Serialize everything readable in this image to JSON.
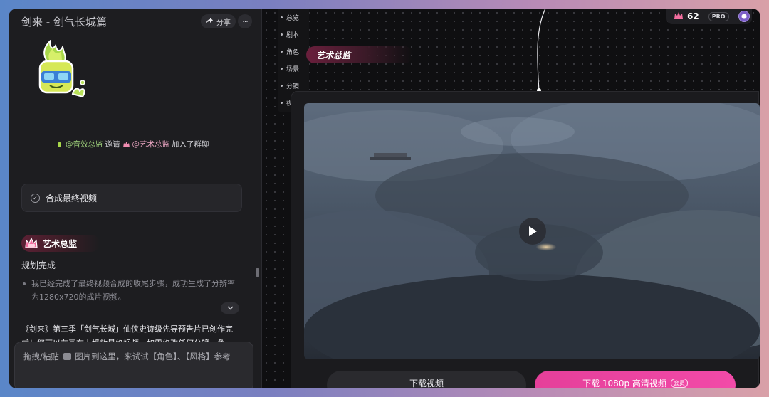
{
  "header": {
    "title": "剑来 - 剑气长城篇",
    "share_label": "分享",
    "more_label": "···"
  },
  "chat": {
    "join_message": {
      "inviter": "@音效总监",
      "action": "邀请",
      "invitee": "@艺术总监",
      "suffix": "加入了群聊"
    },
    "task_card_label": "合成最终视频",
    "agent_name": "艺术总监",
    "status": "规划完成",
    "bullet_text": "我已经完成了最终视频合成的收尾步骤，成功生成了分辨率为1280x720的成片视频。",
    "summary_text": "《剑来》第三季「剑气长城」仙侠史诗级先导预告片已创作完成！您可以在画布上播放最终视频，如需修改任何分镜、角",
    "input_placeholder_before": "拖拽/粘贴",
    "input_placeholder_after": "图片到这里，来试试【角色】、【风格】参考"
  },
  "canvas": {
    "nav_items": [
      "总览",
      "剧本",
      "角色",
      "场景",
      "分镜",
      "视频"
    ],
    "agent_label": "艺术总监",
    "credits": "62",
    "pro_label": "PRO",
    "download_label": "下载视频",
    "download_hd_label": "下载 1080p 高清视频",
    "vip_label": "会员"
  },
  "colors": {
    "accent_pink": "#f24aa8",
    "mention_green": "#9fd27c",
    "mention_pink": "#e7a3bf"
  }
}
